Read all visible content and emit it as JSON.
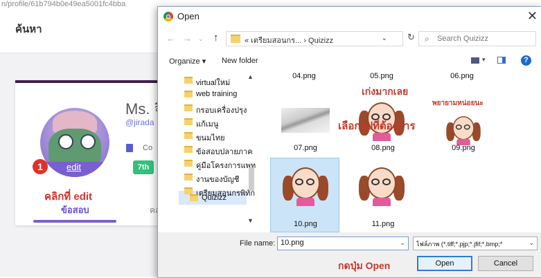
{
  "background": {
    "url_fragment": "n/profile/61b794b0e49ea5001fc4bba",
    "search_heading": "ค้นหา",
    "profile_name": "Ms. จี",
    "profile_handle": "@jirada",
    "course_text": "Co",
    "grade_badge": "7th",
    "edit_link": "edit",
    "tab_exams": "ข้อสอบ",
    "tab_other": "คล"
  },
  "annotations": {
    "step_number": "1",
    "click_edit": "คลิกที่ edit",
    "choose_picture": "เลือกรูปที่ต้องการ",
    "press_open": "กดปุ่ม Open"
  },
  "dialog": {
    "title": "Open",
    "close_glyph": "✕",
    "address_path": "«  เตรียมสอนกร...  ›  Quizizz",
    "search_placeholder": "Search Quizizz",
    "organize_label": "Organize ▾",
    "new_folder_label": "New folder",
    "help_glyph": "?",
    "tree": [
      {
        "label": "virtualใหม่"
      },
      {
        "label": "web training"
      },
      {
        "label": "กรอบเครื่องปรุง"
      },
      {
        "label": "แก้เมนู"
      },
      {
        "label": "ขนมไทย"
      },
      {
        "label": "ข้อสอบปลายภาค"
      },
      {
        "label": "คู่มือโครงการแพท"
      },
      {
        "label": "งานของบัญชี"
      },
      {
        "label": "เตรียมสอนกรพิทัก"
      },
      {
        "label": "Quizizz"
      }
    ],
    "files": [
      {
        "name": "04.png"
      },
      {
        "name": "05.png"
      },
      {
        "name": "06.png"
      },
      {
        "name": "07.png"
      },
      {
        "name": "08.png",
        "caption": "เก่งมากเลย"
      },
      {
        "name": "09.png",
        "caption": "พยายามหน่อยนะ"
      },
      {
        "name": "10.png"
      },
      {
        "name": "11.png"
      }
    ],
    "file_name_label": "File name:",
    "file_name_value": "10.png",
    "file_type_filter": "ไฟล์ภาพ (*.tiff;*.pjp;*.jfif;*.bmp;*",
    "open_button": "Open",
    "cancel_button": "Cancel"
  },
  "colors": {
    "annotation_red": "#c0392b",
    "accent_purple": "#7a5fd0",
    "selection_blue": "#cce4f7"
  }
}
